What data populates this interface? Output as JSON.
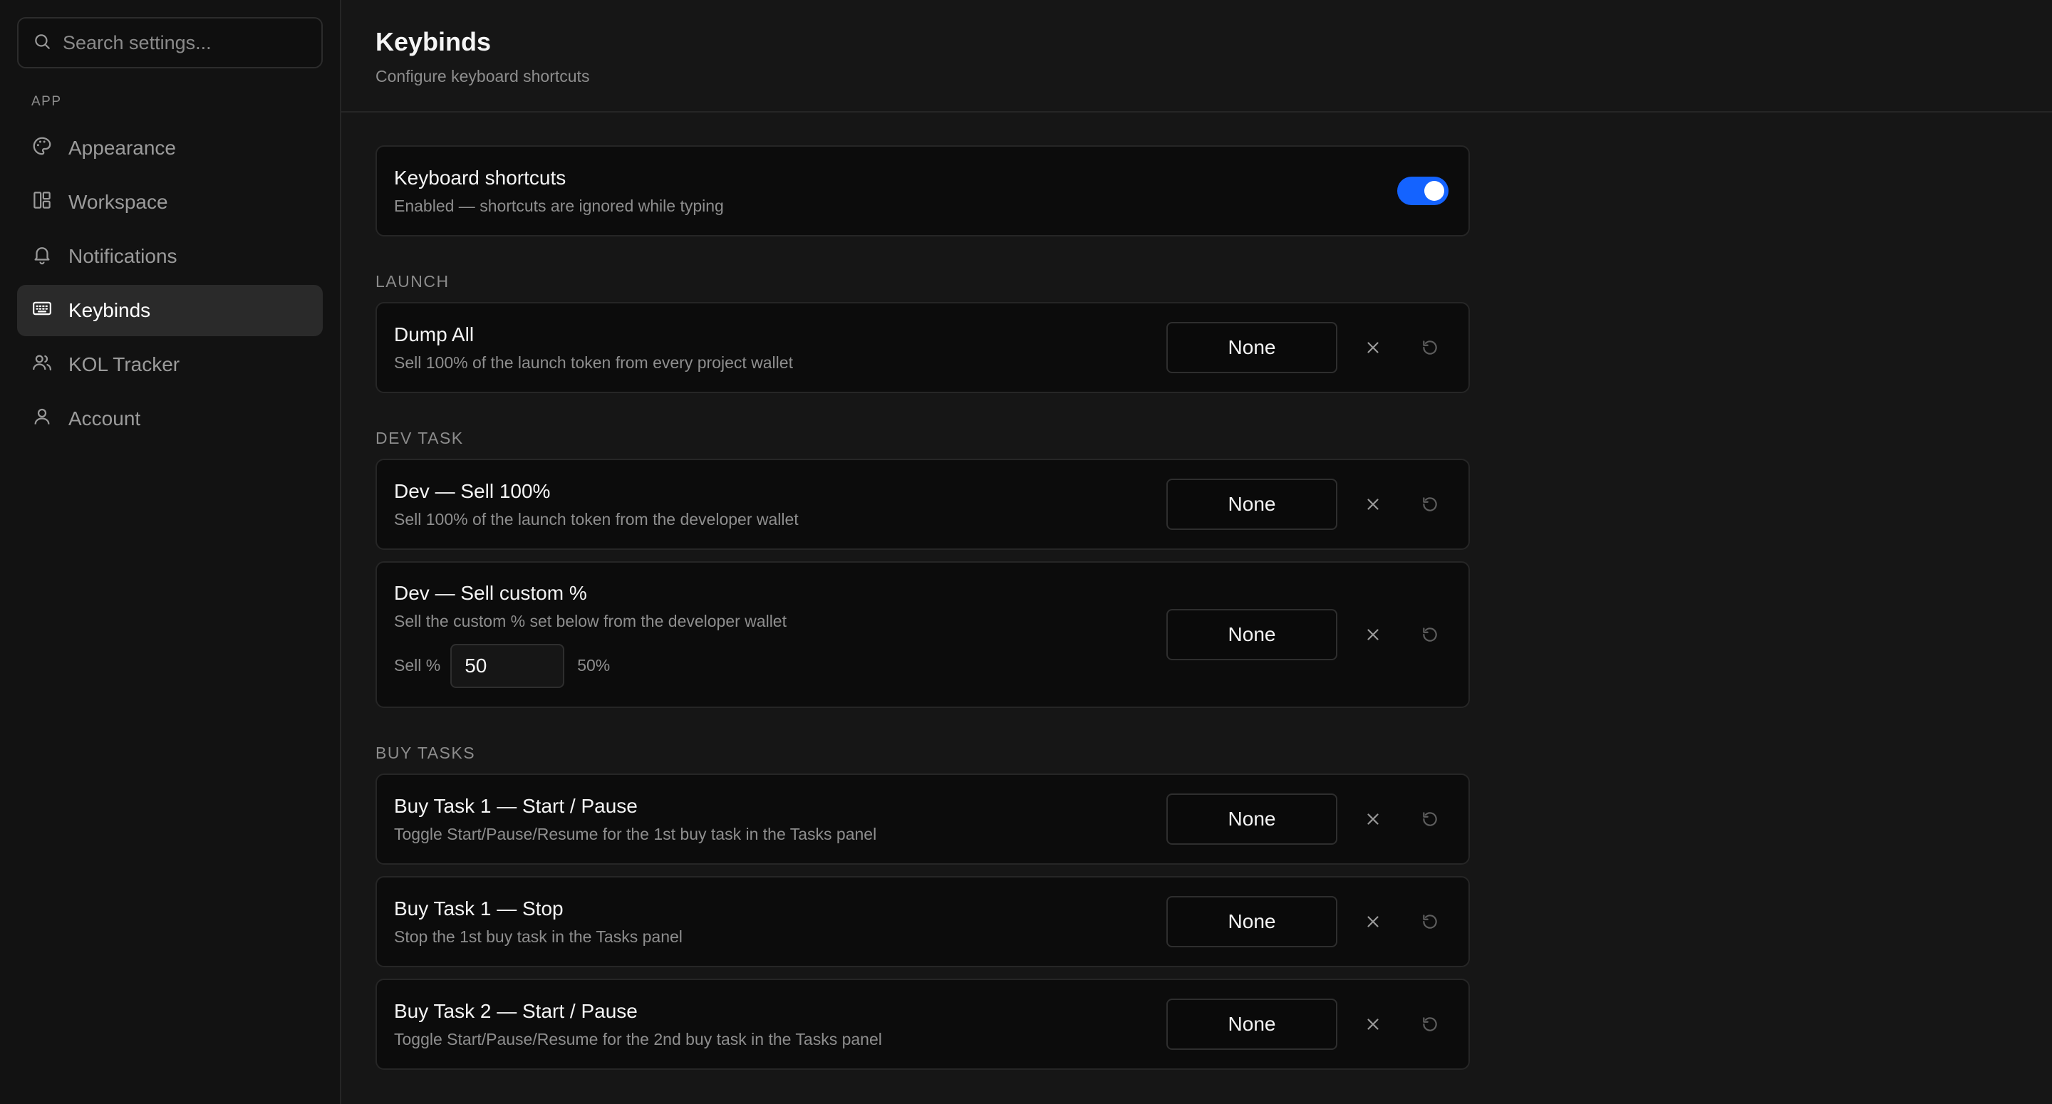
{
  "search": {
    "placeholder": "Search settings..."
  },
  "sidebar": {
    "section_label": "APP",
    "items": [
      {
        "label": "Appearance",
        "icon": "palette-icon"
      },
      {
        "label": "Workspace",
        "icon": "layout-icon"
      },
      {
        "label": "Notifications",
        "icon": "bell-icon"
      },
      {
        "label": "Keybinds",
        "icon": "keyboard-icon",
        "active": true
      },
      {
        "label": "KOL Tracker",
        "icon": "users-icon"
      },
      {
        "label": "Account",
        "icon": "user-icon"
      }
    ]
  },
  "header": {
    "title": "Keybinds",
    "subtitle": "Configure keyboard shortcuts"
  },
  "master": {
    "title": "Keyboard shortcuts",
    "description": "Enabled — shortcuts are ignored while typing",
    "enabled": true
  },
  "groups": {
    "launch": {
      "label": "LAUNCH",
      "items": [
        {
          "title": "Dump All",
          "description": "Sell 100% of the launch token from every project wallet",
          "binding": "None"
        }
      ]
    },
    "dev": {
      "label": "DEV TASK",
      "items": [
        {
          "title": "Dev — Sell 100%",
          "description": "Sell 100% of the launch token from the developer wallet",
          "binding": "None"
        },
        {
          "title": "Dev — Sell custom %",
          "description": "Sell the custom % set below from the developer wallet",
          "binding": "None",
          "sell_label": "Sell %",
          "sell_value": "50",
          "sell_display": "50%"
        }
      ]
    },
    "buy": {
      "label": "BUY TASKS",
      "items": [
        {
          "title": "Buy Task 1 — Start / Pause",
          "description": "Toggle Start/Pause/Resume for the 1st buy task in the Tasks panel",
          "binding": "None"
        },
        {
          "title": "Buy Task 1 — Stop",
          "description": "Stop the 1st buy task in the Tasks panel",
          "binding": "None"
        },
        {
          "title": "Buy Task 2 — Start / Pause",
          "description": "Toggle Start/Pause/Resume for the 2nd buy task in the Tasks panel",
          "binding": "None"
        }
      ]
    }
  },
  "colors": {
    "accent": "#1463ff",
    "background": "#161616",
    "card": "#0c0c0c",
    "sidebar": "#121212"
  }
}
